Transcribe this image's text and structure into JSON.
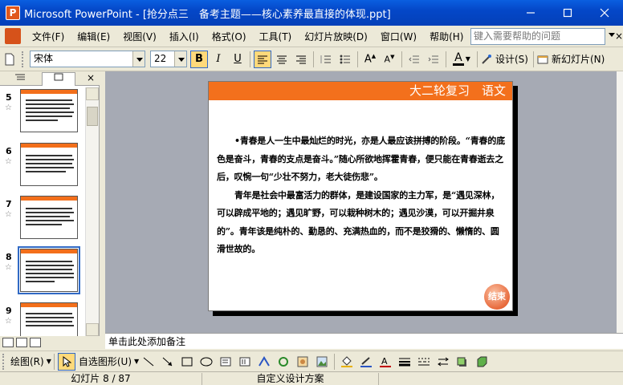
{
  "window": {
    "app_icon_letter": "P",
    "title": "Microsoft PowerPoint - [抢分点三　备考主题——核心素养最直接的体现.ppt]"
  },
  "menu": {
    "items": [
      "文件(F)",
      "编辑(E)",
      "视图(V)",
      "插入(I)",
      "格式(O)",
      "工具(T)",
      "幻灯片放映(D)",
      "窗口(W)",
      "帮助(H)"
    ],
    "help_placeholder": "键入需要帮助的问题",
    "mdi_close": "×"
  },
  "toolbar": {
    "font_name": "宋体",
    "font_size": "22",
    "bold": "B",
    "italic": "I",
    "underline": "U",
    "design_label": "设计(S)",
    "new_slide_label": "新幻灯片(N)"
  },
  "outline_pane": {
    "close": "×",
    "thumbnails": [
      {
        "number": "5"
      },
      {
        "number": "6"
      },
      {
        "number": "7"
      },
      {
        "number": "8",
        "selected": true
      },
      {
        "number": "9"
      }
    ]
  },
  "slide": {
    "header": "大二轮复习　语文",
    "paragraphs": [
      "•青春是人一生中最灿烂的时光，亦是人最应该拼搏的阶段。“青春的底色是奋斗，青春的支点是奋斗。”随心所欲地挥霍青春，便只能在青春逝去之后，叹惋一句“少壮不努力，老大徒伤悲”。",
      "青年是社会中最富活力的群体，是建设国家的主力军，是“遇见深林，可以辟成平地的；遇见旷野，可以栽种树木的；遇见沙漠，可以开掘井泉的”。青年该是纯朴的、勤恳的、充满热血的，而不是狡猾的、懒惰的、圆滑世故的。"
    ],
    "end_button": "结束"
  },
  "notes": {
    "placeholder": "单击此处添加备注"
  },
  "drawing_toolbar": {
    "draw_label": "绘图(R)",
    "autoshape_label": "自选图形(U)"
  },
  "status": {
    "slide_position": "幻灯片 8 / 87",
    "design_template": "自定义设计方案"
  }
}
